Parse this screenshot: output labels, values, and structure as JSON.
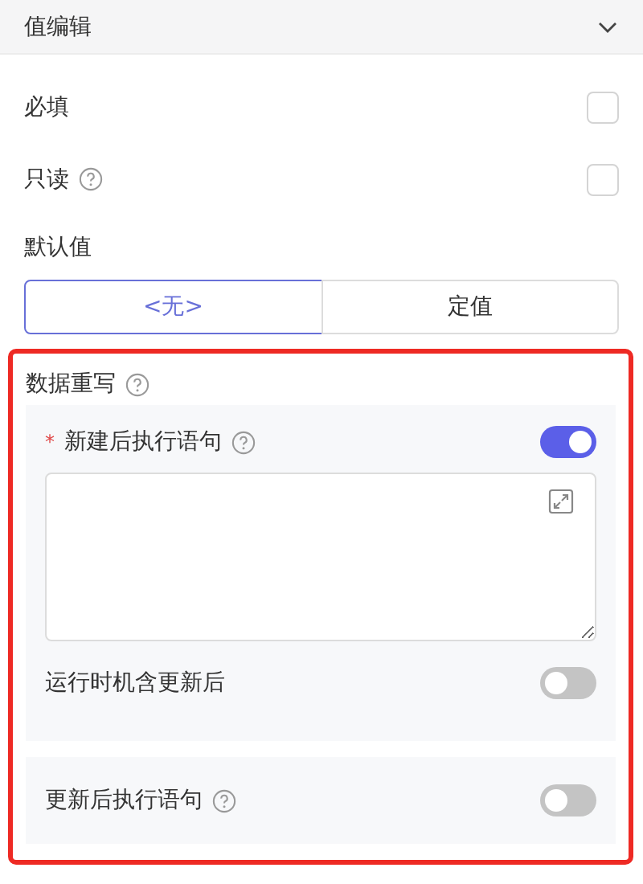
{
  "header": {
    "title": "值编辑",
    "expanded": true
  },
  "checks": [
    {
      "label": "必填",
      "help": false,
      "checked": false
    },
    {
      "label": "只读",
      "help": true,
      "checked": false
    }
  ],
  "default_value": {
    "label": "默认值",
    "options": [
      {
        "label": "<无>",
        "selected": true
      },
      {
        "label": "定值",
        "selected": false
      }
    ]
  },
  "rewrite": {
    "title": "数据重写",
    "highlighted": true,
    "after_create": {
      "label": "新建后执行语句",
      "required_mark": "*",
      "on": true,
      "sub_label": "运行时机含更新后",
      "sub_on": false
    },
    "after_update": {
      "label": "更新后执行语句",
      "on": false
    }
  }
}
